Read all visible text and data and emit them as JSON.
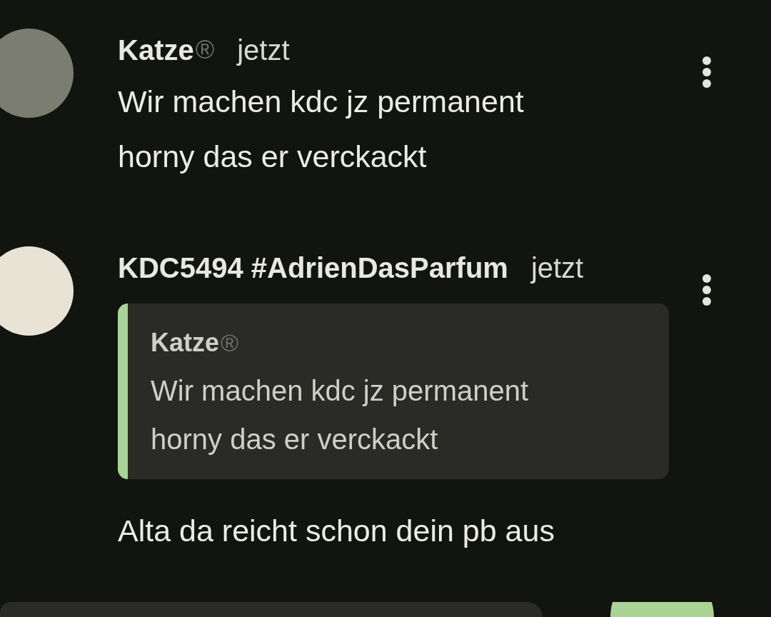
{
  "messages": [
    {
      "author": "Katze",
      "badge": "®",
      "time": "jetzt",
      "text": "Wir machen kdc jz permanent horny das er verckackt"
    },
    {
      "author": "KDC5494 #AdrienDasParfum",
      "time": "jetzt",
      "quote": {
        "author": "Katze",
        "badge": "®",
        "text": "Wir machen kdc jz permanent horny das er verckackt"
      },
      "text": "Alta da reicht schon dein pb aus"
    }
  ]
}
